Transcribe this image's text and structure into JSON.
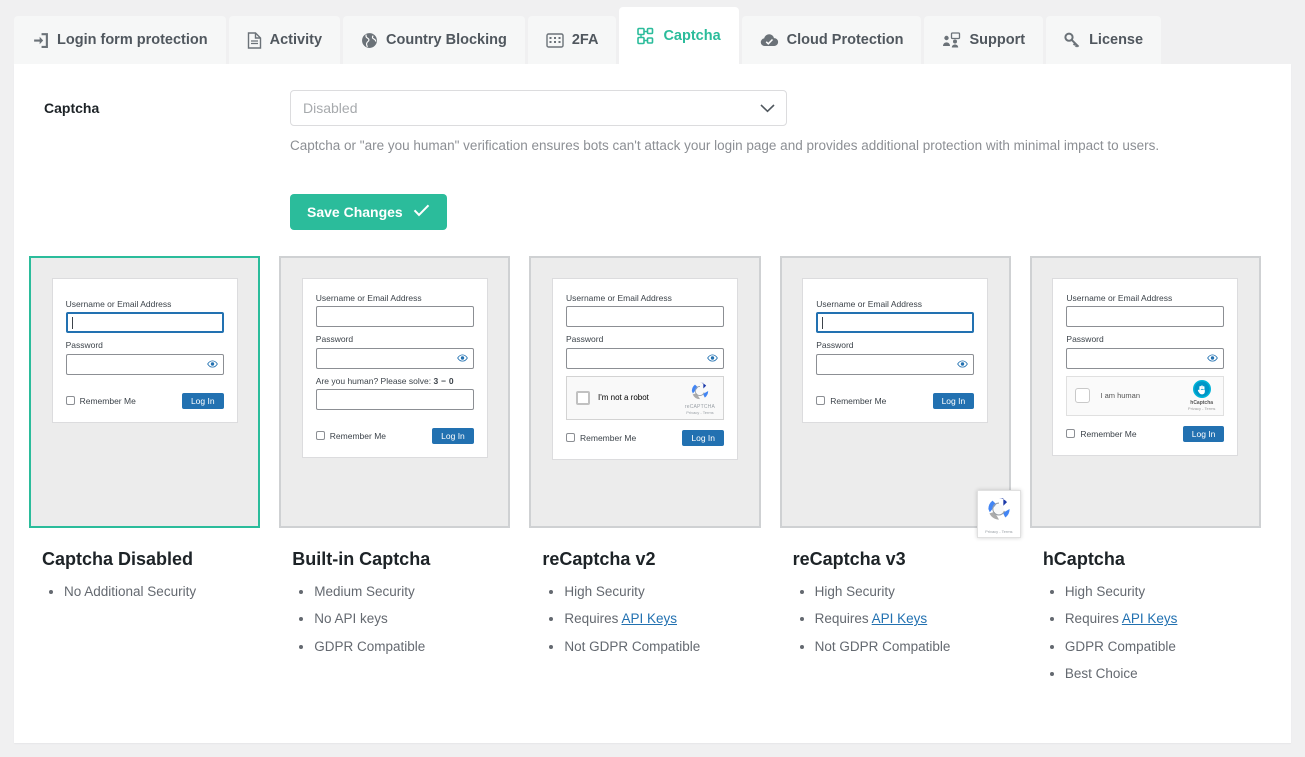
{
  "tabs": [
    {
      "label": "Login form protection",
      "icon": "login-door-icon",
      "active": false
    },
    {
      "label": "Activity",
      "icon": "document-icon",
      "active": false
    },
    {
      "label": "Country Blocking",
      "icon": "globe-icon",
      "active": false
    },
    {
      "label": "2FA",
      "icon": "keypad-icon",
      "active": false
    },
    {
      "label": "Captcha",
      "icon": "captcha-nodes-icon",
      "active": true
    },
    {
      "label": "Cloud Protection",
      "icon": "cloud-check-icon",
      "active": false
    },
    {
      "label": "Support",
      "icon": "support-users-icon",
      "active": false
    },
    {
      "label": "License",
      "icon": "key-icon",
      "active": false
    }
  ],
  "setting": {
    "label": "Captcha",
    "select_value": "Disabled",
    "description": "Captcha or \"are you human\" verification ensures bots can't attack your login page and provides additional protection with minimal impact to users."
  },
  "save_button": {
    "label": "Save Changes",
    "icon": "check-icon",
    "color": "#2bbc9b"
  },
  "form_strings": {
    "username_label": "Username or Email Address",
    "password_label": "Password",
    "remember_label": "Remember Me",
    "login_label": "Log In",
    "math_prompt": "Are you human? Please solve:",
    "math_a": "3",
    "math_op": "−",
    "math_b": "0",
    "recaptcha_text": "I'm not a robot",
    "recaptcha_brand": "reCAPTCHA",
    "recaptcha_terms": "Privacy - Terms",
    "hcaptcha_text": "I am human",
    "hcaptcha_brand": "hCaptcha",
    "hcaptcha_terms": "Privacy - Terms"
  },
  "cards": [
    {
      "id": "captcha-disabled",
      "title": "Captcha Disabled",
      "selected": true,
      "features": [
        {
          "text": "No Additional Security"
        }
      ]
    },
    {
      "id": "built-in-captcha",
      "title": "Built-in Captcha",
      "selected": false,
      "features": [
        {
          "text": "Medium Security"
        },
        {
          "text": "No API keys"
        },
        {
          "text": "GDPR Compatible"
        }
      ]
    },
    {
      "id": "recaptcha-v2",
      "title": "reCaptcha v2",
      "selected": false,
      "features": [
        {
          "text": "High Security"
        },
        {
          "text": "Requires ",
          "link": "API Keys"
        },
        {
          "text": "Not GDPR Compatible"
        }
      ]
    },
    {
      "id": "recaptcha-v3",
      "title": "reCaptcha v3",
      "selected": false,
      "features": [
        {
          "text": "High Security"
        },
        {
          "text": "Requires ",
          "link": "API Keys"
        },
        {
          "text": "Not GDPR Compatible"
        }
      ]
    },
    {
      "id": "hcaptcha",
      "title": "hCaptcha",
      "selected": false,
      "features": [
        {
          "text": "High Security"
        },
        {
          "text": "Requires ",
          "link": "API Keys"
        },
        {
          "text": "GDPR Compatible"
        },
        {
          "text": "Best Choice"
        }
      ]
    }
  ],
  "colors": {
    "accent": "#2bbc9b",
    "link": "#2271b1",
    "wp_blue": "#2271b1"
  }
}
